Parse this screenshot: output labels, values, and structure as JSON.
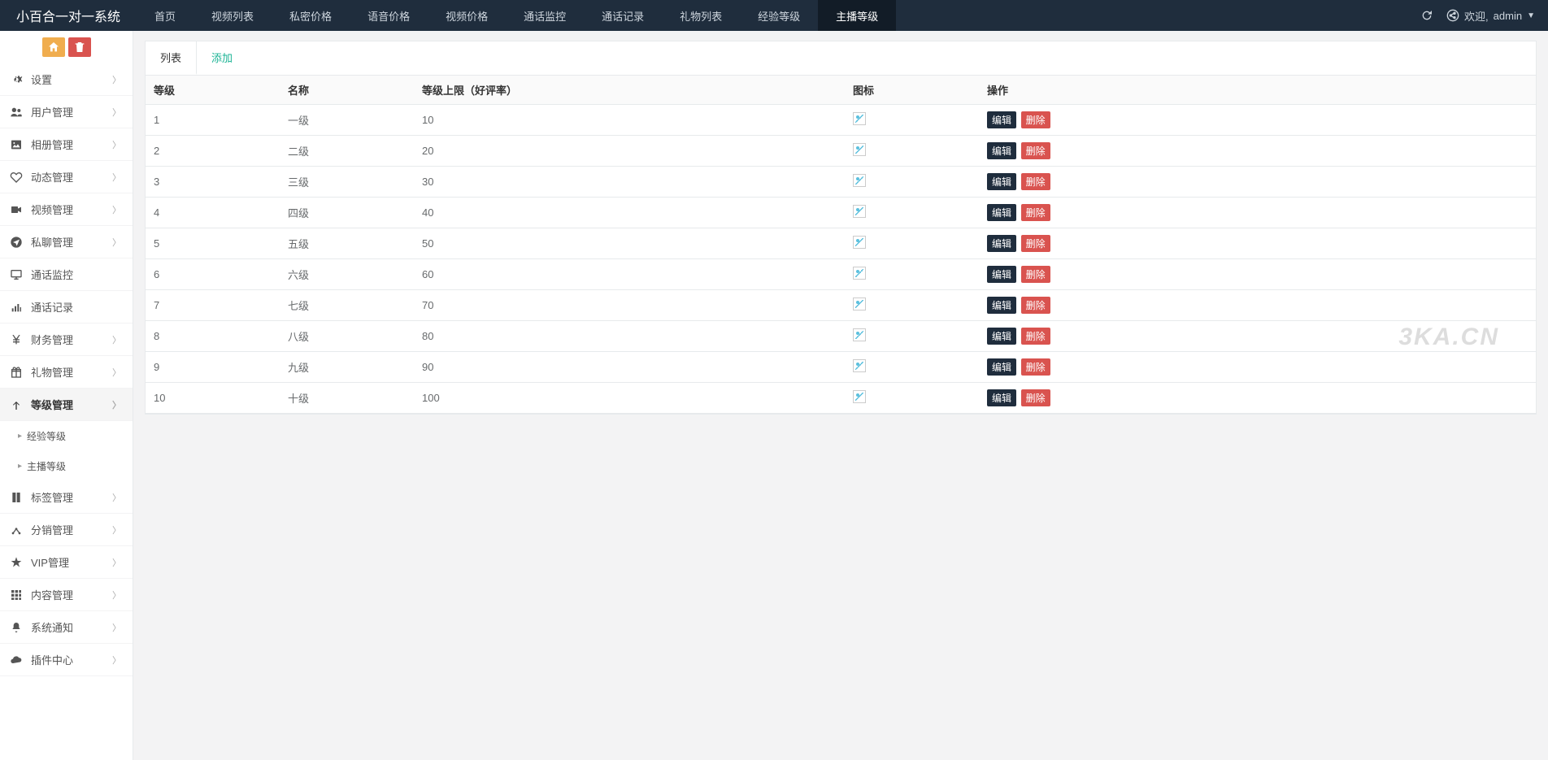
{
  "brand": "小百合一对一系统",
  "topNav": [
    "首页",
    "视频列表",
    "私密价格",
    "语音价格",
    "视频价格",
    "通话监控",
    "通话记录",
    "礼物列表",
    "经验等级",
    "主播等级"
  ],
  "topNavActive": 9,
  "welcome": {
    "prefix": "欢迎,",
    "user": "admin"
  },
  "sidebar": {
    "items": [
      {
        "icon": "cogs",
        "label": "设置",
        "hasSub": true
      },
      {
        "icon": "users",
        "label": "用户管理",
        "hasSub": true
      },
      {
        "icon": "image",
        "label": "相册管理",
        "hasSub": true
      },
      {
        "icon": "heart",
        "label": "动态管理",
        "hasSub": true
      },
      {
        "icon": "video",
        "label": "视频管理",
        "hasSub": true
      },
      {
        "icon": "send",
        "label": "私聊管理",
        "hasSub": true
      },
      {
        "icon": "monitor",
        "label": "通话监控",
        "hasSub": false
      },
      {
        "icon": "record",
        "label": "通话记录",
        "hasSub": false
      },
      {
        "icon": "yen",
        "label": "财务管理",
        "hasSub": true
      },
      {
        "icon": "gift",
        "label": "礼物管理",
        "hasSub": true
      },
      {
        "icon": "level",
        "label": "等级管理",
        "hasSub": true,
        "active": true,
        "sub": [
          "经验等级",
          "主播等级"
        ]
      },
      {
        "icon": "tag",
        "label": "标签管理",
        "hasSub": true
      },
      {
        "icon": "share",
        "label": "分销管理",
        "hasSub": true
      },
      {
        "icon": "star",
        "label": "VIP管理",
        "hasSub": true
      },
      {
        "icon": "grid",
        "label": "内容管理",
        "hasSub": true
      },
      {
        "icon": "bell",
        "label": "系统通知",
        "hasSub": true
      },
      {
        "icon": "cloud",
        "label": "插件中心",
        "hasSub": true
      }
    ]
  },
  "tabs": {
    "list": "列表",
    "add": "添加"
  },
  "table": {
    "headers": {
      "level": "等级",
      "name": "名称",
      "limit": "等级上限（好评率）",
      "icon": "图标",
      "action": "操作"
    },
    "editLabel": "编辑",
    "deleteLabel": "删除",
    "rows": [
      {
        "level": "1",
        "name": "一级",
        "limit": "10"
      },
      {
        "level": "2",
        "name": "二级",
        "limit": "20"
      },
      {
        "level": "3",
        "name": "三级",
        "limit": "30"
      },
      {
        "level": "4",
        "name": "四级",
        "limit": "40"
      },
      {
        "level": "5",
        "name": "五级",
        "limit": "50"
      },
      {
        "level": "6",
        "name": "六级",
        "limit": "60"
      },
      {
        "level": "7",
        "name": "七级",
        "limit": "70"
      },
      {
        "level": "8",
        "name": "八级",
        "limit": "80"
      },
      {
        "level": "9",
        "name": "九级",
        "limit": "90"
      },
      {
        "level": "10",
        "name": "十级",
        "limit": "100"
      }
    ]
  },
  "watermark": "3KA.CN"
}
